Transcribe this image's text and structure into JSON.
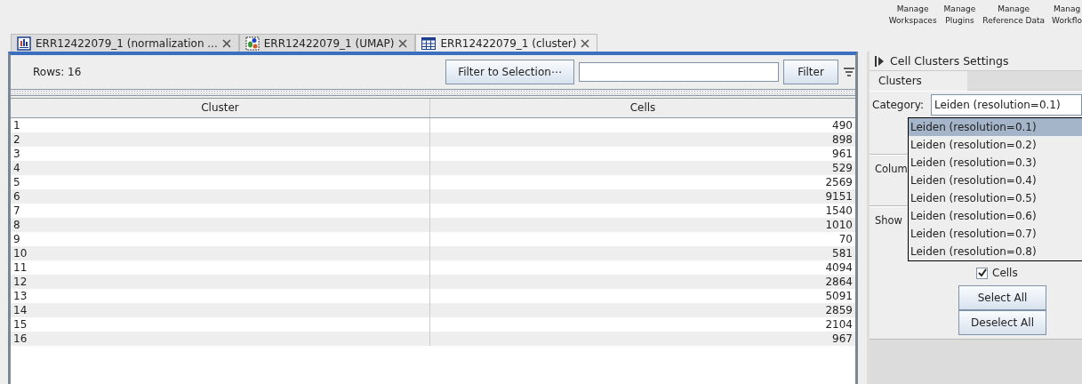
{
  "toolbar": {
    "buttons": [
      {
        "line1": "Manage",
        "line2": "Workspaces"
      },
      {
        "line1": "Manage",
        "line2": "Plugins"
      },
      {
        "line1": "Manage",
        "line2": "Reference Data"
      },
      {
        "line1": "Manag",
        "line2": "Workflo"
      }
    ]
  },
  "tabs": [
    {
      "label": "ERR12422079_1 (normalization ...",
      "kind": "chart",
      "selected": false
    },
    {
      "label": "ERR12422079_1 (UMAP)",
      "kind": "scatter",
      "selected": false
    },
    {
      "label": "ERR12422079_1 (cluster)",
      "kind": "table",
      "selected": true
    }
  ],
  "table_toolbar": {
    "rows_label": "Rows: 16",
    "filter_to_selection": "Filter to Selection⋯",
    "filter": "Filter"
  },
  "table": {
    "columns": [
      "Cluster",
      "Cells"
    ],
    "rows": [
      [
        "1",
        "490"
      ],
      [
        "2",
        "898"
      ],
      [
        "3",
        "961"
      ],
      [
        "4",
        "529"
      ],
      [
        "5",
        "2569"
      ],
      [
        "6",
        "9151"
      ],
      [
        "7",
        "1540"
      ],
      [
        "8",
        "1010"
      ],
      [
        "9",
        "70"
      ],
      [
        "10",
        "581"
      ],
      [
        "11",
        "4094"
      ],
      [
        "12",
        "2864"
      ],
      [
        "13",
        "5091"
      ],
      [
        "14",
        "2859"
      ],
      [
        "15",
        "2104"
      ],
      [
        "16",
        "967"
      ]
    ]
  },
  "settings": {
    "title": "Cell Clusters Settings",
    "tab": "Clusters",
    "category_label": "Category:",
    "category_value": "Leiden (resolution=0.1)",
    "dropdown": [
      {
        "label": "Leiden (resolution=0.1)",
        "selected": true
      },
      {
        "label": "Leiden (resolution=0.2)",
        "selected": false
      },
      {
        "label": "Leiden (resolution=0.3)",
        "selected": false
      },
      {
        "label": "Leiden (resolution=0.4)",
        "selected": false
      },
      {
        "label": "Leiden (resolution=0.5)",
        "selected": false
      },
      {
        "label": "Leiden (resolution=0.6)",
        "selected": false
      },
      {
        "label": "Leiden (resolution=0.7)",
        "selected": false
      },
      {
        "label": "Leiden (resolution=0.8)",
        "selected": false
      }
    ],
    "columns_label": "Colum",
    "show_label": "Show",
    "checkboxes": [
      {
        "label": "Cells",
        "checked": true
      }
    ],
    "buttons": [
      "Select All",
      "Deselect All"
    ]
  }
}
